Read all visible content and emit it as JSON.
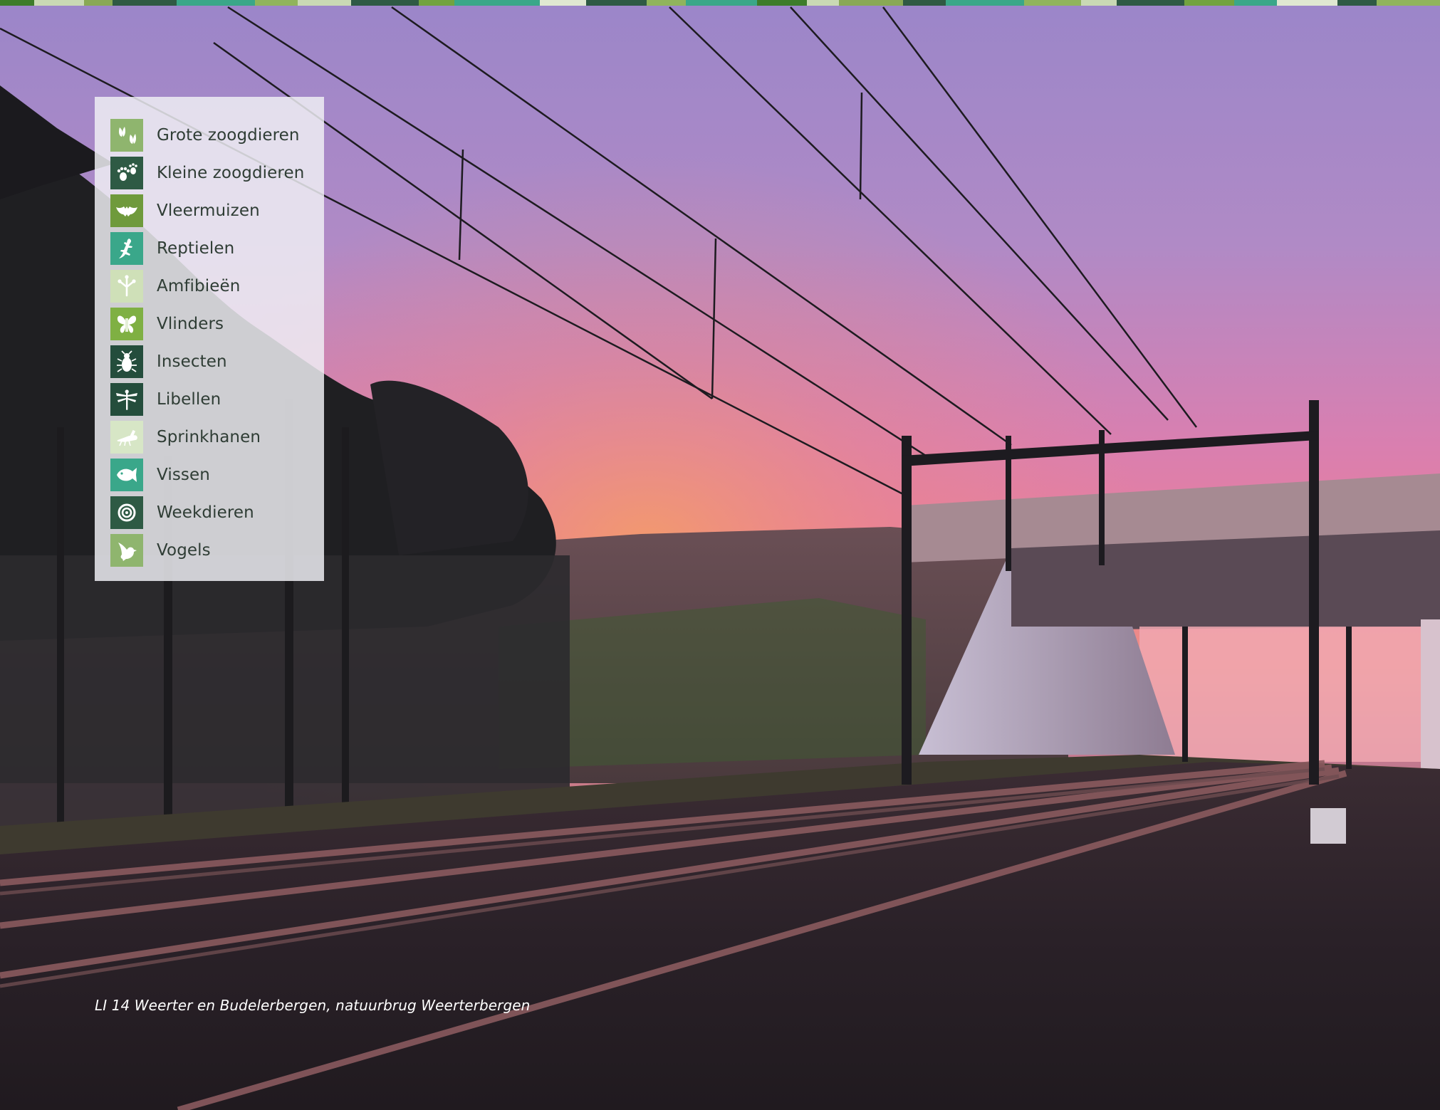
{
  "legend": {
    "items": [
      {
        "label": "Grote zoogdieren",
        "icon": "hoofprint-icon",
        "color": "#8fb56e"
      },
      {
        "label": "Kleine zoogdieren",
        "icon": "pawprint-icon",
        "color": "#2e5a44"
      },
      {
        "label": "Vleermuizen",
        "icon": "bat-icon",
        "color": "#6f9a3c"
      },
      {
        "label": "Reptielen",
        "icon": "lizard-icon",
        "color": "#3aa78a"
      },
      {
        "label": "Amfibieën",
        "icon": "frog-foot-icon",
        "color": "#cfe0b8"
      },
      {
        "label": "Vlinders",
        "icon": "butterfly-icon",
        "color": "#7fb043"
      },
      {
        "label": "Insecten",
        "icon": "beetle-icon",
        "color": "#244d3c"
      },
      {
        "label": "Libellen",
        "icon": "dragonfly-icon",
        "color": "#244d3c"
      },
      {
        "label": "Sprinkhanen",
        "icon": "grasshopper-icon",
        "color": "#d7e6c6"
      },
      {
        "label": "Vissen",
        "icon": "fish-icon",
        "color": "#3aa78a"
      },
      {
        "label": "Weekdieren",
        "icon": "snail-icon",
        "color": "#2e5a44"
      },
      {
        "label": "Vogels",
        "icon": "bird-icon",
        "color": "#8fb56e"
      }
    ]
  },
  "caption": "LI 14 Weerter en Budelerbergen, natuurbrug Weerterbergen",
  "colors": {
    "strip": [
      "#3d7c2a",
      "#c9d9b4",
      "#89a955",
      "#2f5a43",
      "#3aa789",
      "#90b45c",
      "#c9d9b4",
      "#2e5a44",
      "#72a33f",
      "#3aa789",
      "#dfe8d1",
      "#2e5a44",
      "#90b45c",
      "#3aa789"
    ]
  }
}
